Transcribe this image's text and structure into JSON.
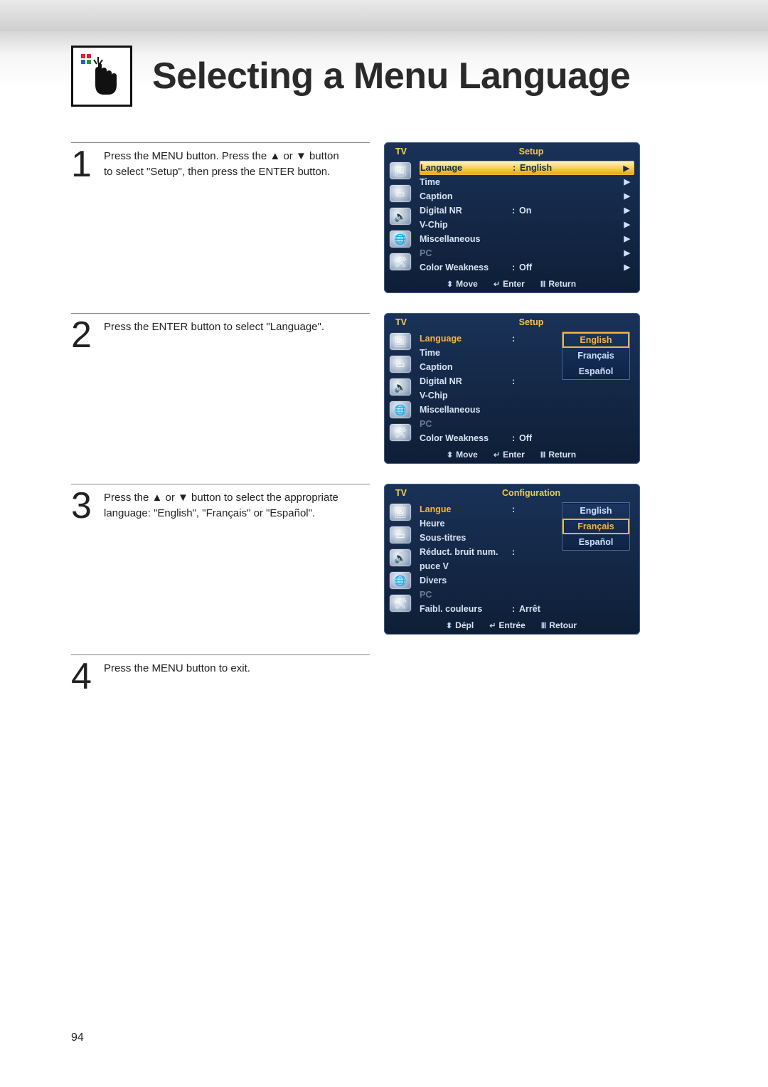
{
  "page_title": "Selecting a Menu Language",
  "page_number": "94",
  "steps": [
    {
      "num": "1",
      "text": "Press the MENU button. Press the ▲ or ▼ button to select \"Setup\", then press the ENTER button."
    },
    {
      "num": "2",
      "text": "Press the ENTER button to select \"Language\"."
    },
    {
      "num": "3",
      "text": "Press the ▲ or ▼ button to select the appropriate language: \"English\", \"Français\" or \"Español\"."
    },
    {
      "num": "4",
      "text": "Press the MENU button to exit."
    }
  ],
  "osd_common": {
    "tv": "TV",
    "footer": {
      "move": "Move",
      "enter": "Enter",
      "return": "Return"
    },
    "footer_fr": {
      "move": "Dépl",
      "enter": "Entrée",
      "return": "Retour"
    }
  },
  "osd1": {
    "title": "Setup",
    "items": [
      {
        "label": "Language",
        "value": "English"
      },
      {
        "label": "Time",
        "value": ""
      },
      {
        "label": "Caption",
        "value": ""
      },
      {
        "label": "Digital NR",
        "value": "On"
      },
      {
        "label": "V-Chip",
        "value": ""
      },
      {
        "label": "Miscellaneous",
        "value": ""
      },
      {
        "label": "PC",
        "value": ""
      },
      {
        "label": "Color Weakness",
        "value": "Off"
      }
    ]
  },
  "osd2": {
    "title": "Setup",
    "items": [
      {
        "label": "Language"
      },
      {
        "label": "Time"
      },
      {
        "label": "Caption"
      },
      {
        "label": "Digital NR"
      },
      {
        "label": "V-Chip"
      },
      {
        "label": "Miscellaneous"
      },
      {
        "label": "PC"
      },
      {
        "label": "Color Weakness",
        "value": "Off"
      }
    ],
    "popup": [
      "English",
      "Français",
      "Español"
    ],
    "popup_selected": "English"
  },
  "osd3": {
    "title": "Configuration",
    "items": [
      {
        "label": "Langue"
      },
      {
        "label": "Heure"
      },
      {
        "label": "Sous-titres"
      },
      {
        "label": "Réduct. bruit num."
      },
      {
        "label": "puce V"
      },
      {
        "label": "Divers"
      },
      {
        "label": "PC"
      },
      {
        "label": "Faibl. couleurs",
        "value": "Arrêt"
      }
    ],
    "popup": [
      "English",
      "Français",
      "Español"
    ],
    "popup_selected": "Français"
  }
}
